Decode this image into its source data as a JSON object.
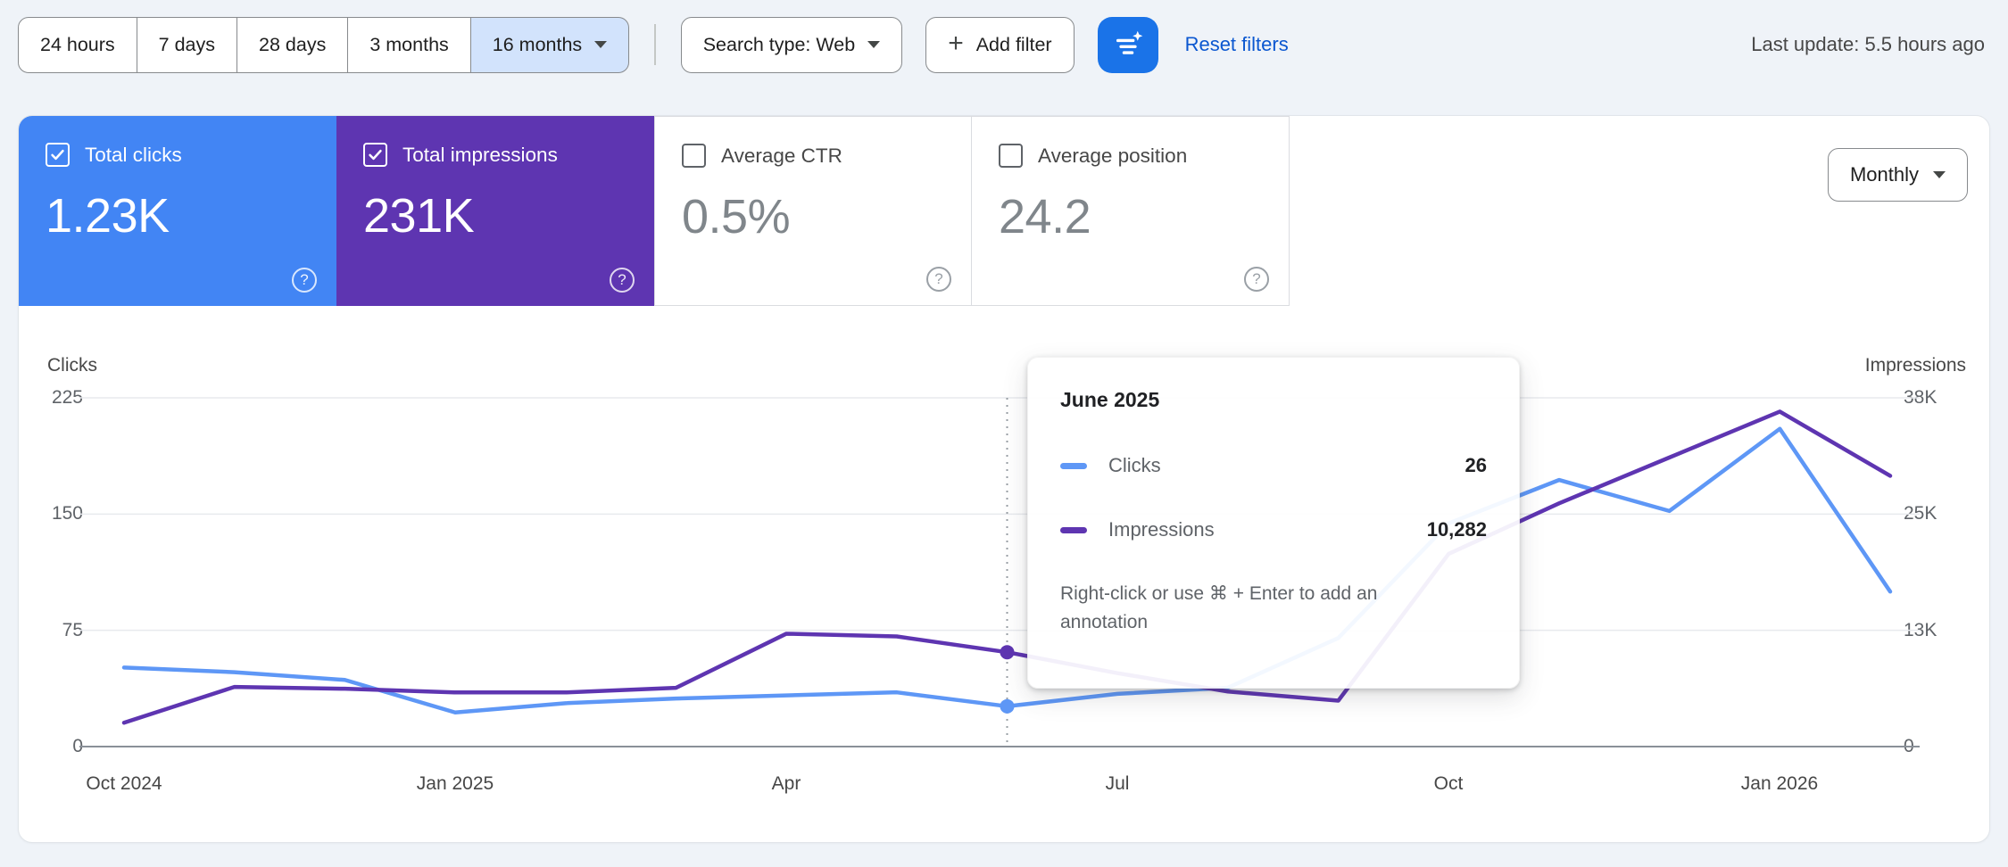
{
  "toolbar": {
    "date_ranges": [
      {
        "label": "24 hours",
        "selected": false
      },
      {
        "label": "7 days",
        "selected": false
      },
      {
        "label": "28 days",
        "selected": false
      },
      {
        "label": "3 months",
        "selected": false
      },
      {
        "label": "16 months",
        "selected": true
      }
    ],
    "search_type_label": "Search type: Web",
    "plus_glyph": "+",
    "add_filter_label": "Add filter",
    "reset_filters_label": "Reset filters",
    "last_update": "Last update: 5.5 hours ago"
  },
  "metrics": {
    "help_glyph": "?",
    "granularity_label": "Monthly",
    "tiles": [
      {
        "label": "Total clicks",
        "value": "1.23K",
        "checked": true,
        "color": "#4285f4"
      },
      {
        "label": "Total impressions",
        "value": "231K",
        "checked": true,
        "color": "#5e35b1"
      },
      {
        "label": "Average CTR",
        "value": "0.5%",
        "checked": false
      },
      {
        "label": "Average position",
        "value": "24.2",
        "checked": false
      }
    ]
  },
  "chart_data": {
    "type": "line",
    "x": [
      "Oct 2024",
      "Nov 2024",
      "Dec 2024",
      "Jan 2025",
      "Feb 2025",
      "Mar 2025",
      "Apr 2025",
      "May 2025",
      "Jun 2025",
      "Jul 2025",
      "Aug 2025",
      "Sep 2025",
      "Oct 2025",
      "Nov 2025",
      "Dec 2025",
      "Jan 2026",
      "Feb 2026"
    ],
    "series": [
      {
        "name": "Clicks",
        "axis": "left",
        "color": "#5e97f6",
        "values": [
          51,
          48,
          43,
          22,
          28,
          31,
          33,
          35,
          26,
          34,
          38,
          70,
          144,
          172,
          152,
          205,
          100
        ]
      },
      {
        "name": "Impressions",
        "axis": "right",
        "color": "#5e35b1",
        "values": [
          2600,
          6500,
          6300,
          5900,
          5900,
          6400,
          12300,
          12000,
          10282,
          8000,
          6000,
          5000,
          21000,
          26500,
          31500,
          36500,
          29500
        ]
      }
    ],
    "left_axis": {
      "title": "Clicks",
      "max": 225,
      "ticks": [
        225,
        150,
        75,
        0
      ],
      "tick_labels": [
        "225",
        "150",
        "75",
        "0"
      ]
    },
    "right_axis": {
      "title": "Impressions",
      "max": 38000,
      "ticks": [
        38000,
        25333,
        12667,
        0
      ],
      "tick_labels": [
        "38K",
        "25K",
        "13K",
        "0"
      ]
    },
    "x_tick_labels": [
      "Oct 2024",
      "Jan 2025",
      "Apr",
      "Jul",
      "Oct",
      "Jan 2026"
    ],
    "grid": true,
    "legend_position": "none",
    "hover": {
      "index": 8,
      "month": "June 2025",
      "clicks_display": "26",
      "impressions_display": "10,282"
    },
    "tooltip_hint": "Right-click or use ⌘ + Enter to add an annotation"
  }
}
